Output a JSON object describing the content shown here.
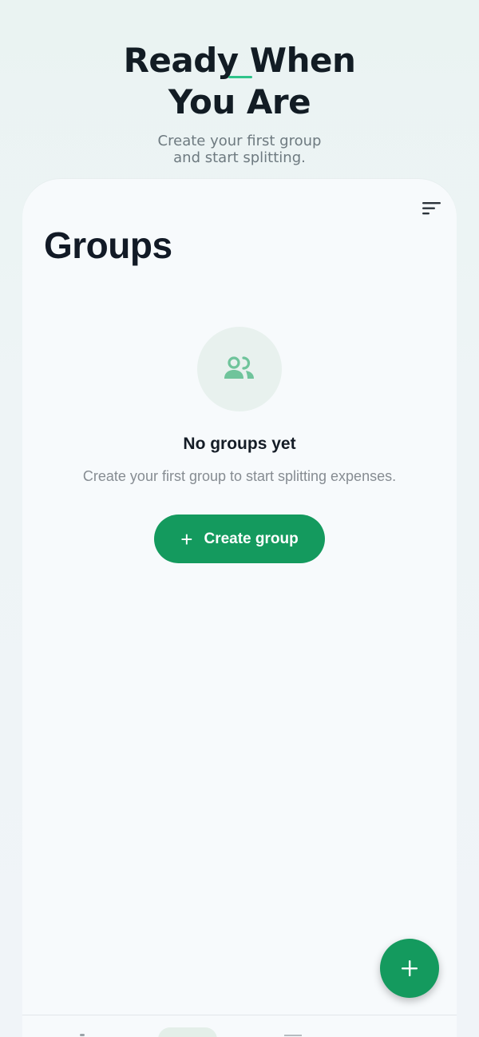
{
  "hero": {
    "title_line1": "Ready When",
    "title_line2": "You Are",
    "subtitle_line1": "Create your first group",
    "subtitle_line2": "and start splitting."
  },
  "screen": {
    "title": "Groups",
    "sort_icon": "sort-icon",
    "empty_state": {
      "icon": "people-icon",
      "title": "No groups yet",
      "description": "Create your first group to start splitting expenses."
    },
    "create_button": {
      "icon": "plus-icon",
      "label": "Create group"
    },
    "fab_icon": "plus-icon"
  },
  "colors": {
    "accent": "#149a5e",
    "accent_light": "#2fc48a",
    "title_text": "#121c24",
    "muted_text": "#868c92"
  }
}
